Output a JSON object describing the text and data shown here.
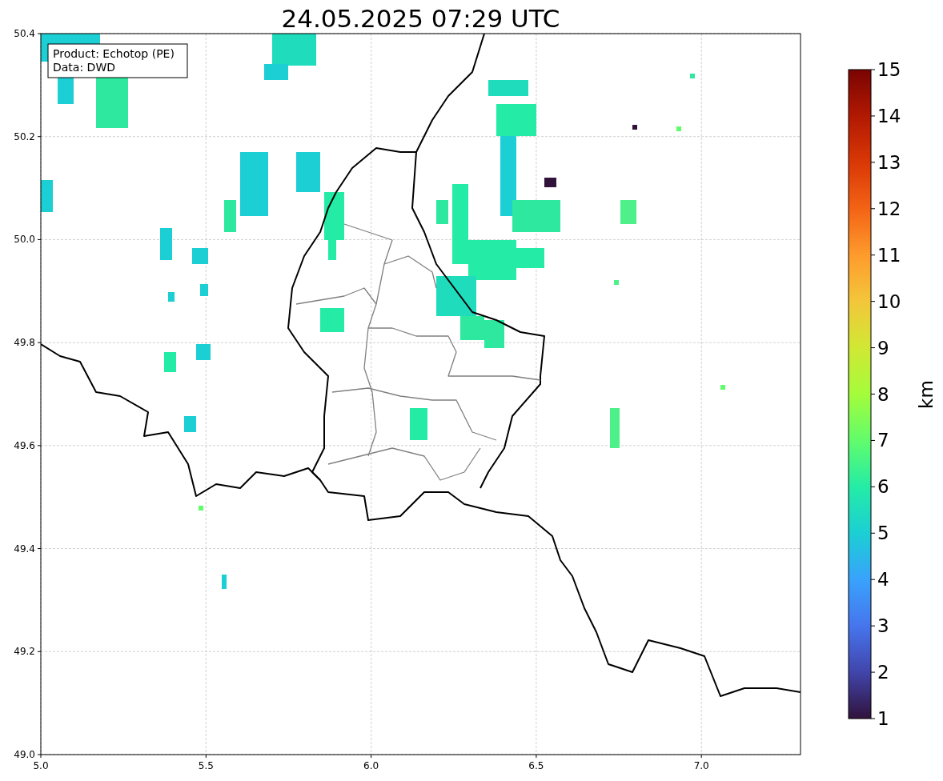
{
  "title": "24.05.2025 07:29 UTC",
  "info_box": [
    "Product: Echotop (PE)",
    "Data: DWD"
  ],
  "x_ticks": [
    "5.0",
    "5.5",
    "6.0",
    "6.5",
    "7.0"
  ],
  "y_ticks": [
    "50.4",
    "50.2",
    "50.0",
    "49.8",
    "49.6",
    "49.4",
    "49.2",
    "49.0"
  ],
  "colorbar": {
    "label": "km",
    "ticks": [
      "15",
      "14",
      "13",
      "12",
      "11",
      "10",
      "9",
      "8",
      "7",
      "6",
      "5",
      "4",
      "3",
      "2",
      "1"
    ]
  }
}
